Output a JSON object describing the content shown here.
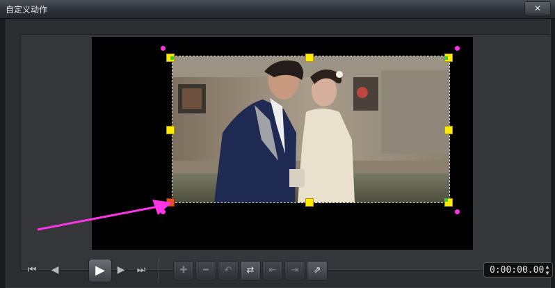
{
  "window": {
    "title": "自定义动作",
    "close_label": "✕"
  },
  "preview": {
    "photo_description_visible": false
  },
  "transport": {
    "home_icon": "⏮",
    "prev_frame_icon": "◀",
    "play_icon": "▶",
    "next_frame_icon": "▶",
    "end_icon": "⏭"
  },
  "keyframe_tools": [
    {
      "name": "add-keyframe-button",
      "glyph": "✚",
      "enabled": false
    },
    {
      "name": "remove-keyframe-button",
      "glyph": "━",
      "enabled": false
    },
    {
      "name": "reverse-keyframe-button",
      "glyph": "↶",
      "enabled": false
    },
    {
      "name": "swap-keyframe-button",
      "glyph": "⇄",
      "enabled": true
    },
    {
      "name": "move-left-keyframe-button",
      "glyph": "⇤",
      "enabled": false
    },
    {
      "name": "move-right-keyframe-button",
      "glyph": "⇥",
      "enabled": false
    },
    {
      "name": "copy-keyframe-button",
      "glyph": "⇗",
      "enabled": true
    }
  ],
  "timecode": {
    "value": "0:00:00.00"
  },
  "colors": {
    "handle": "#ffec00",
    "rotation_handle": "#ff34e6",
    "arrow": "#ff34e6"
  }
}
